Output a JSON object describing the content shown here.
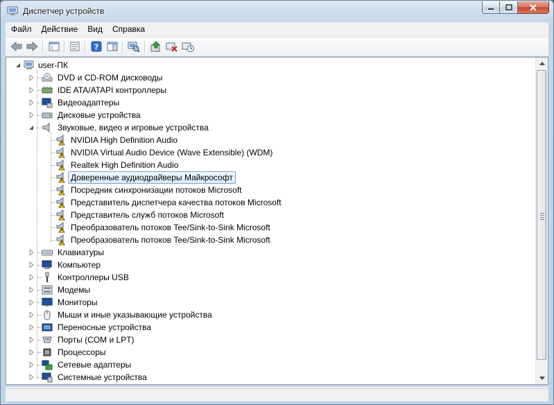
{
  "window": {
    "title": "Диспетчер устройств",
    "accent": "#c3d6ea"
  },
  "menu": [
    "Файл",
    "Действие",
    "Вид",
    "Справка"
  ],
  "toolbar": {
    "icons": [
      "back-arrow-icon",
      "forward-arrow-icon",
      "show-hide-tree-icon",
      "properties-icon",
      "help-icon",
      "action-pane-icon",
      "scan-hardware-icon",
      "update-driver-icon",
      "disable-device-icon",
      "uninstall-device-icon"
    ]
  },
  "tree": {
    "root": "user-ПК",
    "categories": [
      {
        "label": "DVD и CD-ROM дисководы",
        "icon": "dvd-drive-icon",
        "expanded": false
      },
      {
        "label": "IDE ATA/ATAPI контроллеры",
        "icon": "ide-controller-icon",
        "expanded": false
      },
      {
        "label": "Видеоадаптеры",
        "icon": "display-adapter-icon",
        "expanded": false
      },
      {
        "label": "Дисковые устройства",
        "icon": "disk-drive-icon",
        "expanded": false
      },
      {
        "label": "Звуковые, видео и игровые устройства",
        "icon": "speaker-icon",
        "expanded": true,
        "children": [
          {
            "label": "NVIDIA High Definition Audio",
            "warning": true
          },
          {
            "label": "NVIDIA Virtual Audio Device (Wave Extensible) (WDM)",
            "warning": true
          },
          {
            "label": "Realtek High Definition Audio",
            "warning": true
          },
          {
            "label": "Доверенные аудиодрайверы Майкрософт",
            "warning": true,
            "selected": true
          },
          {
            "label": "Посредник синхронизации потоков Microsoft",
            "warning": true
          },
          {
            "label": "Представитель диспетчера качества потоков Microsoft",
            "warning": true
          },
          {
            "label": "Представитель служб потоков Microsoft",
            "warning": true
          },
          {
            "label": "Преобразователь потоков Tee/Sink-to-Sink Microsoft",
            "warning": true
          },
          {
            "label": "Преобразователь потоков Tee/Sink-to-Sink Microsoft",
            "warning": true
          }
        ]
      },
      {
        "label": "Клавиатуры",
        "icon": "keyboard-icon",
        "expanded": false
      },
      {
        "label": "Компьютер",
        "icon": "computer-icon",
        "expanded": false
      },
      {
        "label": "Контроллеры USB",
        "icon": "usb-icon",
        "expanded": false
      },
      {
        "label": "Модемы",
        "icon": "modem-icon",
        "expanded": false
      },
      {
        "label": "Мониторы",
        "icon": "monitor-icon",
        "expanded": false
      },
      {
        "label": "Мыши и иные указывающие устройства",
        "icon": "mouse-icon",
        "expanded": false
      },
      {
        "label": "Переносные устройства",
        "icon": "portable-device-icon",
        "expanded": false
      },
      {
        "label": "Порты (COM и LPT)",
        "icon": "port-icon",
        "expanded": false
      },
      {
        "label": "Процессоры",
        "icon": "processor-icon",
        "expanded": false
      },
      {
        "label": "Сетевые адаптеры",
        "icon": "network-adapter-icon",
        "expanded": false
      },
      {
        "label": "Системные устройства",
        "icon": "system-device-icon",
        "expanded": false
      }
    ]
  }
}
